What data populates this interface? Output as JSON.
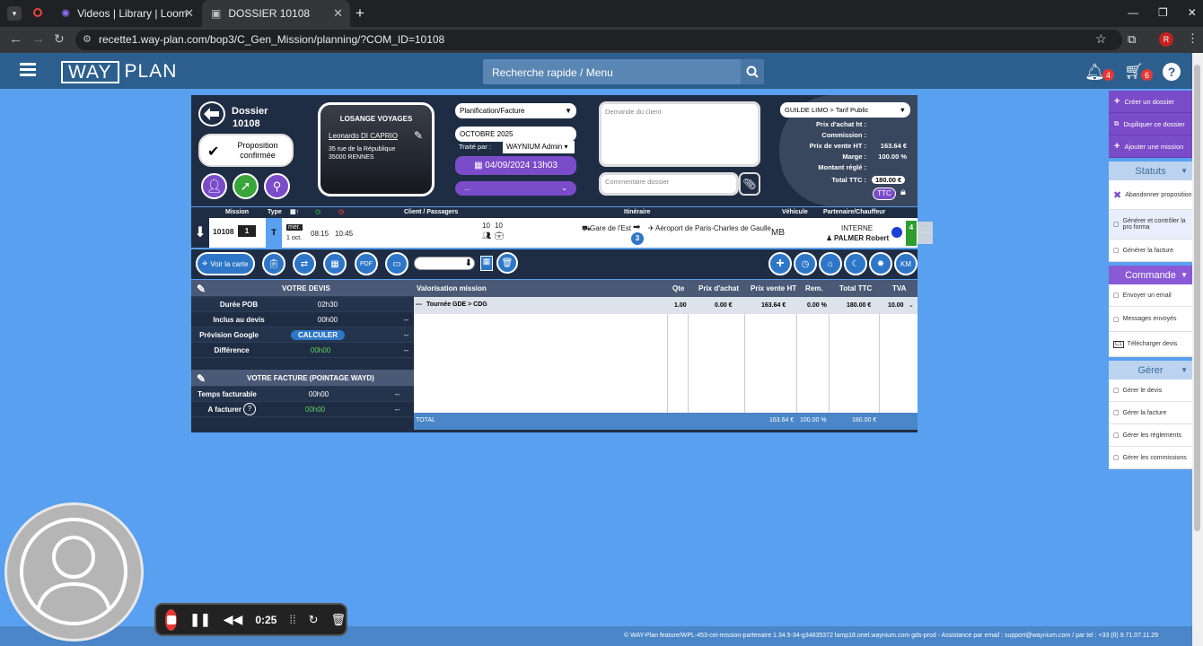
{
  "browser": {
    "tabs": [
      {
        "title": "Videos | Library | Loom"
      },
      {
        "title": "DOSSIER 10108"
      }
    ],
    "url": "recette1.way-plan.com/bop3/C_Gen_Mission/planning/?COM_ID=10108",
    "profile_initial": "R"
  },
  "header": {
    "logo_way": "WAY",
    "logo_plan": "PLAN",
    "search_placeholder": "Recherche rapide / Menu",
    "notif_count": "4",
    "cart_count": "6"
  },
  "dossier": {
    "label": "Dossier",
    "number": "10108",
    "status": "Proposition confirmée",
    "client": {
      "company": "LOSANGE VOYAGES",
      "contact": "Leonardo DI CAPRIO",
      "address1": "35 rue de la République",
      "address2": "35000 RENNES"
    },
    "type_select": "Planification/Facture",
    "month": "OCTOBRE 2025",
    "traite_par_label": "Traité par :",
    "traite_par": "WAYNIUM Admin",
    "date": "04/09/2024 13h03",
    "extra_select": "...",
    "demande_placeholder": "Demande du client",
    "commentaire_placeholder": "Commentaire dossier"
  },
  "pricing": {
    "tarif": "GUILDE LIMO > Tarif Public",
    "rows": [
      {
        "label": "Prix d'achat ht :",
        "value": ""
      },
      {
        "label": "Commission :",
        "value": ""
      },
      {
        "label": "Prix de vente HT :",
        "value": "163.64 €"
      },
      {
        "label": "Marge :",
        "value": "100.00 %"
      },
      {
        "label": "Montant réglé :",
        "value": ""
      },
      {
        "label": "Total TTC :",
        "value": "180.00 €"
      }
    ],
    "ttc_btn": "TTC"
  },
  "mission_table": {
    "headers": [
      "Mission",
      "Type",
      "",
      "",
      "",
      "Client / Passagers",
      "Itinéraire",
      "Véhicule",
      "Partenaire/Chauffeur"
    ],
    "row": {
      "id": "10108",
      "count": "1",
      "type": "T",
      "day": "mer.",
      "date": "1 oct.",
      "time_start": "08:15",
      "time_end": "10:45",
      "pax": "10",
      "bags": "10",
      "from": "Gare de l'Est",
      "steps": "3",
      "to": "Aéroport de Paris-Charles de Gaulle",
      "vehicle": "MB",
      "partner": "INTERNE",
      "driver": "PALMER Robert",
      "badge": "4"
    }
  },
  "toolbar": {
    "map_btn": "Voir la carte"
  },
  "devis": {
    "title": "VOTRE DEVIS",
    "rows": [
      {
        "label": "Durée POB",
        "value": "02h30",
        "extra": ""
      },
      {
        "label": "Inclus au devis",
        "value": "00h00",
        "extra": "--"
      },
      {
        "label": "Prévision Google",
        "value": "CALCULER",
        "extra": "--"
      },
      {
        "label": "Différence",
        "value": "00h00",
        "extra": "--"
      }
    ],
    "facture_title": "VOTRE FACTURE (POINTAGE WAYD)",
    "facture_rows": [
      {
        "label": "Temps facturable",
        "value": "00h00",
        "extra": "--"
      },
      {
        "label": "A facturer",
        "value": "00h00",
        "extra": "--"
      }
    ]
  },
  "valorisation": {
    "headers": [
      "Valorisation mission",
      "Qte",
      "Prix d'achat",
      "Prix vente HT",
      "Rem.",
      "Total TTC",
      "TVA"
    ],
    "row": {
      "label": "Tournée GDE > CDG",
      "prefix": "---",
      "qte": "1.00",
      "achat": "0.00 €",
      "vente": "163.64 €",
      "rem": "0.00 %",
      "ttc": "180.00 €",
      "tva": "10.00"
    },
    "total_label": "TOTAL",
    "total_vente": "163.64 €",
    "total_rem": "100.00 %",
    "total_ttc": "180.00 €"
  },
  "sidebar": {
    "actions": [
      "Créer un dossier",
      "Dupliquer ce dossier",
      "Ajouter une mission"
    ],
    "statuts_title": "Statuts",
    "statuts": [
      "Abandonner proposition",
      "Générer et contrôler la pro forma",
      "Générer la facture"
    ],
    "commande_title": "Commande",
    "commande": [
      "Envoyer un email",
      "Messages envoyés",
      "Télécharger devis"
    ],
    "gerer_title": "Gérer",
    "gerer": [
      "Gérer le devis",
      "Gérer la facture",
      "Gérer les règlements",
      "Gérer les commissions"
    ]
  },
  "footer": {
    "text": "© WAY-Plan feature/WPL-453-cei-mission-partenaire 1.34.5-34-g34835372 lamp18.onet.waynium.com gds-prod - Assistance par email : support@waynium.com / par tel : +33 (0) 9.71.07.11.29"
  },
  "recorder": {
    "time": "0:25"
  }
}
